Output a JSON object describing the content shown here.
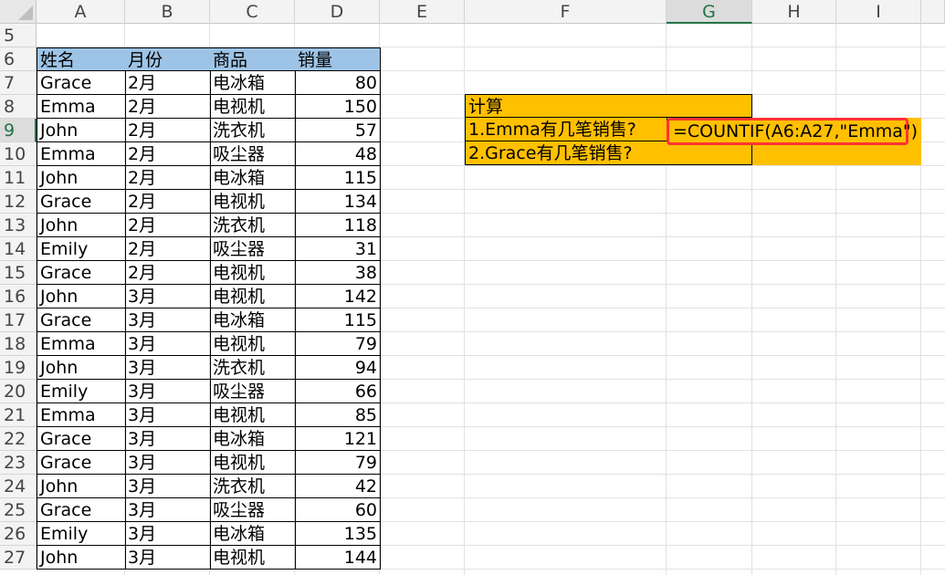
{
  "columns": [
    "A",
    "B",
    "C",
    "D",
    "E",
    "F",
    "G",
    "H",
    "I"
  ],
  "rows": [
    "5",
    "6",
    "7",
    "8",
    "9",
    "10",
    "11",
    "12",
    "13",
    "14",
    "15",
    "16",
    "17",
    "18",
    "19",
    "20",
    "21",
    "22",
    "23",
    "24",
    "25",
    "26",
    "27"
  ],
  "table": {
    "headers": [
      "姓名",
      "月份",
      "商品",
      "销量"
    ],
    "records": [
      [
        "Grace",
        "2月",
        "电冰箱",
        "80"
      ],
      [
        "Emma",
        "2月",
        "电视机",
        "150"
      ],
      [
        "John",
        "2月",
        "洗衣机",
        "57"
      ],
      [
        "Emma",
        "2月",
        "吸尘器",
        "48"
      ],
      [
        "John",
        "2月",
        "电冰箱",
        "115"
      ],
      [
        "Grace",
        "2月",
        "电视机",
        "134"
      ],
      [
        "John",
        "2月",
        "洗衣机",
        "118"
      ],
      [
        "Emily",
        "2月",
        "吸尘器",
        "31"
      ],
      [
        "Grace",
        "2月",
        "电视机",
        "38"
      ],
      [
        "John",
        "3月",
        "电视机",
        "142"
      ],
      [
        "Grace",
        "3月",
        "电冰箱",
        "115"
      ],
      [
        "Emma",
        "3月",
        "电视机",
        "79"
      ],
      [
        "John",
        "3月",
        "洗衣机",
        "94"
      ],
      [
        "Emily",
        "3月",
        "吸尘器",
        "66"
      ],
      [
        "Emma",
        "3月",
        "电视机",
        "85"
      ],
      [
        "Grace",
        "3月",
        "电冰箱",
        "121"
      ],
      [
        "Grace",
        "3月",
        "电视机",
        "79"
      ],
      [
        "John",
        "3月",
        "洗衣机",
        "42"
      ],
      [
        "Grace",
        "3月",
        "吸尘器",
        "60"
      ],
      [
        "Emily",
        "3月",
        "电冰箱",
        "135"
      ],
      [
        "John",
        "3月",
        "电视机",
        "144"
      ]
    ]
  },
  "calc": {
    "title": "计算",
    "q1": "1.Emma有几笔销售?",
    "q2": "2.Grace有几笔销售?",
    "formula": "=COUNTIF(A6:A27,\"Emma\")"
  },
  "selection": {
    "column": "G",
    "row": "9"
  },
  "colors": {
    "header_fill": "#9dc3e6",
    "calc_fill": "#ffc000",
    "highlight_border": "#ff3333",
    "selected_accent": "#217346"
  }
}
